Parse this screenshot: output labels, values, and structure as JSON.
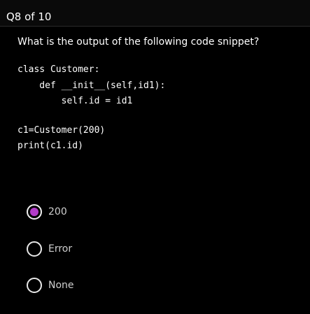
{
  "header": {
    "counter": "Q8 of 10"
  },
  "question": {
    "prompt": "What is the output of the following code snippet?",
    "code_lines": [
      "class Customer:",
      "    def __init__(self,id1):",
      "        self.id = id1",
      "",
      "c1=Customer(200)",
      "print(c1.id)"
    ]
  },
  "options": [
    {
      "label": "200",
      "selected": true
    },
    {
      "label": "Error",
      "selected": false
    },
    {
      "label": "None",
      "selected": false
    }
  ],
  "colors": {
    "background": "#000000",
    "selected_radio": "#b23cc8"
  }
}
